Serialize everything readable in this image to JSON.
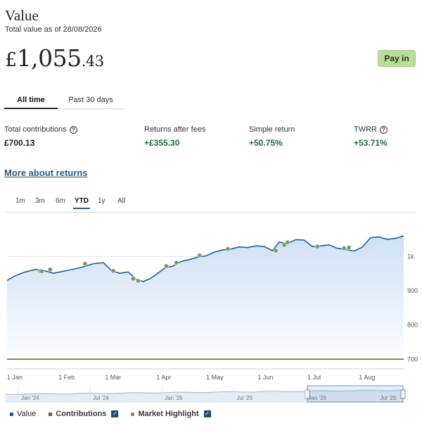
{
  "header": {
    "title": "Value",
    "subtitle": "Total value as of 28/08/2026",
    "value_currency": "£",
    "value_whole": "1,055",
    "value_decimal": ".43",
    "pay_in_label": "Pay in"
  },
  "period_tabs": [
    {
      "label": "All time",
      "active": true
    },
    {
      "label": "Past 30 days",
      "active": false
    }
  ],
  "stats": [
    {
      "label": "Total contributions",
      "value": "£700.13",
      "has_help": true,
      "color": "#1f1f1f"
    },
    {
      "label": "Returns after fees",
      "value": "+£355.30",
      "has_help": false,
      "color": "#1e6b3a"
    },
    {
      "label": "Simple return",
      "value": "+50.75%",
      "has_help": false,
      "color": "#1e6b3a"
    },
    {
      "label": "TWRR",
      "value": "+53.71%",
      "has_help": true,
      "color": "#1e6b3a"
    }
  ],
  "more_link": "More about returns",
  "range_tabs": [
    {
      "label": "1m",
      "active": false
    },
    {
      "label": "3m",
      "active": false
    },
    {
      "label": "6m",
      "active": false
    },
    {
      "label": "YTD",
      "active": true
    },
    {
      "label": "1y",
      "active": false
    },
    {
      "label": "All",
      "active": false
    }
  ],
  "colors": {
    "value_line": "#1c5e9e",
    "area_top": "#cfe0f4",
    "area_bottom": "#ffffff",
    "contributions": "#8b4a2b",
    "highlight": "#7a9a5a",
    "accent_green": "#1e6b3a",
    "link": "#2a5d84"
  },
  "legend": [
    {
      "label": "Value",
      "color": "#1c5e9e",
      "checkbox": false
    },
    {
      "label": "Contributions",
      "color": "#8b4a2b",
      "checkbox": true
    },
    {
      "label": "Market Highlight",
      "color": "#7a9a5a",
      "checkbox": true
    }
  ],
  "chart_data": {
    "type": "area",
    "title": "",
    "xlabel": "",
    "ylabel": "",
    "x_ticks": [
      "1 Jan",
      "1 Feb",
      "1 Mar",
      "1 Apr",
      "1 May",
      "1 Jun",
      "1 Jul",
      "1 Aug"
    ],
    "y_ticks": [
      {
        "value": 700,
        "label": "700"
      },
      {
        "value": 800,
        "label": "800"
      },
      {
        "value": 900,
        "label": "900"
      },
      {
        "value": 1000,
        "label": "1k"
      }
    ],
    "xlim": [
      "2026-01-01",
      "2026-08-28"
    ],
    "ylim": [
      680,
      1120
    ],
    "grid": true,
    "series": [
      {
        "name": "Value",
        "x": [
          "2026-01-01",
          "2026-01-06",
          "2026-01-12",
          "2026-01-18",
          "2026-01-24",
          "2026-01-29",
          "2026-02-04",
          "2026-02-10",
          "2026-02-16",
          "2026-02-22",
          "2026-02-28",
          "2026-03-05",
          "2026-03-10",
          "2026-03-15",
          "2026-03-20",
          "2026-03-24",
          "2026-03-28",
          "2026-04-01",
          "2026-04-06",
          "2026-04-11",
          "2026-04-16",
          "2026-04-21",
          "2026-04-26",
          "2026-05-01",
          "2026-05-06",
          "2026-05-11",
          "2026-05-16",
          "2026-05-21",
          "2026-05-26",
          "2026-05-31",
          "2026-06-05",
          "2026-06-10",
          "2026-06-14",
          "2026-06-19",
          "2026-06-24",
          "2026-06-29",
          "2026-07-04",
          "2026-07-09",
          "2026-07-14",
          "2026-07-19",
          "2026-07-24",
          "2026-07-29",
          "2026-08-03",
          "2026-08-08",
          "2026-08-13",
          "2026-08-18",
          "2026-08-23",
          "2026-08-28"
        ],
        "values": [
          930,
          944,
          955,
          962,
          958,
          951,
          957,
          963,
          970,
          979,
          982,
          958,
          951,
          955,
          933,
          927,
          935,
          948,
          966,
          972,
          986,
          991,
          998,
          1002,
          1013,
          1019,
          1022,
          1028,
          1026,
          1031,
          1029,
          1017,
          1042,
          1038,
          1049,
          1048,
          1029,
          1031,
          1034,
          1024,
          1021,
          1016,
          1027,
          1055,
          1057,
          1050,
          1053,
          1060
        ]
      },
      {
        "name": "Contributions",
        "x": [
          "2026-01-01",
          "2026-08-28"
        ],
        "values": [
          700.13,
          700.13
        ]
      }
    ],
    "highlights": {
      "name": "Market Highlight",
      "x": [
        "2026-01-21",
        "2026-01-22",
        "2026-01-27",
        "2026-02-17",
        "2026-03-06",
        "2026-03-18",
        "2026-03-21",
        "2026-04-07",
        "2026-04-13",
        "2026-04-27",
        "2026-05-14",
        "2026-06-12",
        "2026-06-17",
        "2026-06-19",
        "2026-07-07",
        "2026-07-23",
        "2026-07-26"
      ],
      "values": [
        958,
        957,
        962,
        979,
        958,
        935,
        929,
        972,
        982,
        1003,
        1022,
        1017,
        1034,
        1041,
        1029,
        1024,
        1026
      ]
    },
    "navigator": {
      "ticks": [
        "Jan '24",
        "Jul '24",
        "Jan '25",
        "Jul '25",
        "Jan '26",
        "Jul '26"
      ],
      "selected_range": [
        "2026-01-01",
        "2026-08-28"
      ]
    }
  }
}
